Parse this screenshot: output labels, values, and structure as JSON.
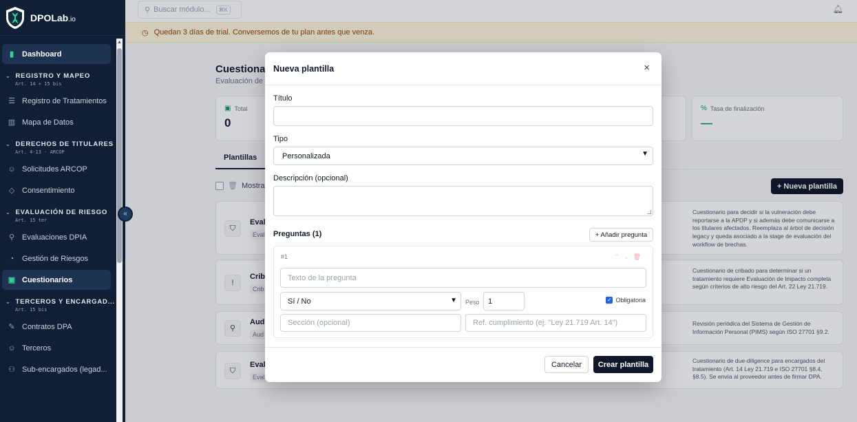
{
  "app": {
    "brand": "DPOLab",
    "brand_suffix": ".io"
  },
  "sidebar": {
    "dashboard": "Dashboard",
    "sections": [
      {
        "title": "REGISTRO Y MAPEO",
        "sub": "Art. 14 + 15 bis",
        "items": [
          {
            "label": "Registro de Tratamientos",
            "icon": "database-icon"
          },
          {
            "label": "Mapa de Datos",
            "icon": "map-icon"
          }
        ]
      },
      {
        "title": "DERECHOS DE TITULARES",
        "sub": "Art. 4-13 · ARCOP",
        "items": [
          {
            "label": "Solicitudes ARCOP",
            "icon": "users-icon"
          },
          {
            "label": "Consentimiento",
            "icon": "shield-icon"
          }
        ]
      },
      {
        "title": "EVALUACIÓN DE RIESGO",
        "sub": "Art. 15 ter",
        "items": [
          {
            "label": "Evaluaciones DPIA",
            "icon": "search-icon"
          },
          {
            "label": "Gestión de Riesgos",
            "icon": "gauge-icon"
          },
          {
            "label": "Cuestionarios",
            "icon": "clipboard-icon",
            "active": true
          }
        ]
      },
      {
        "title": "TERCEROS Y ENCARGAD...",
        "sub": "Art. 15 bis",
        "items": [
          {
            "label": "Contratos DPA",
            "icon": "contract-icon"
          },
          {
            "label": "Terceros",
            "icon": "users-icon"
          },
          {
            "label": "Sub-encargados (legad...",
            "icon": "network-icon"
          }
        ]
      }
    ]
  },
  "topbar": {
    "search_placeholder": "Buscar módulo...",
    "shortcut": "⌘K"
  },
  "trial": {
    "text": "Quedan 3 días de trial. Conversemos de tu plan antes que venza."
  },
  "page": {
    "title": "Cuestiona",
    "subtitle": "Evaluación de p",
    "stats": [
      {
        "label": "Total",
        "value": "0"
      },
      {
        "label": "Tasa de finalización",
        "value": "—"
      }
    ],
    "tab": "Plantillas",
    "filter_label": "Mostrar",
    "new_button": "+ Nueva plantilla",
    "rows": [
      {
        "name": "Evalu",
        "badge": "Eval",
        "icon": "shield-icon",
        "desc": "Cuestionario para decidir si la vulneración debe reportarse a la APDP y si además debe comunicarse a los titulares afectados. Reemplaza al árbol de decisión legacy y queda asociado a la stage de evaluación del workflow de brechas."
      },
      {
        "name": "Criba",
        "badge": "Crib",
        "icon": "alert-icon",
        "desc": "Cuestionario de cribado para determinar si un tratamiento requiere Evaluación de Impacto completa según criterios de alto riesgo del Art. 22 Ley 21.719."
      },
      {
        "name": "Audi",
        "badge": "Aud",
        "icon": "search-icon",
        "desc": "Revisión periódica del Sistema de Gestión de Información Personal (PIMS) según ISO 27701 §9.2."
      },
      {
        "name": "Evalu",
        "badge": "Eval",
        "icon": "shield-icon",
        "desc": "Cuestionario de due-diligence para encargados del tratamiento (Art. 14 Ley 21.719 e ISO 27701 §8.4, §8.5). Se envía al proveedor antes de firmar DPA."
      }
    ]
  },
  "modal": {
    "title": "Nueva plantilla",
    "titulo_label": "Título",
    "titulo_value": "",
    "tipo_label": "Tipo",
    "tipo_value": "Personalizada",
    "descripcion_label": "Descripción (opcional)",
    "preguntas_label": "Preguntas (1)",
    "add_question": "+ Añadir pregunta",
    "question": {
      "number": "#1",
      "text_placeholder": "Texto de la pregunta",
      "type_value": "Sí / No",
      "peso_label": "Peso",
      "peso_value": "1",
      "obligatoria_label": "Obligatoria",
      "seccion_placeholder": "Sección (opcional)",
      "ref_placeholder": "Ref. cumplimiento (ej. \"Ley 21.719 Art. 14\")"
    },
    "cancel": "Cancelar",
    "create": "Crear plantilla"
  }
}
